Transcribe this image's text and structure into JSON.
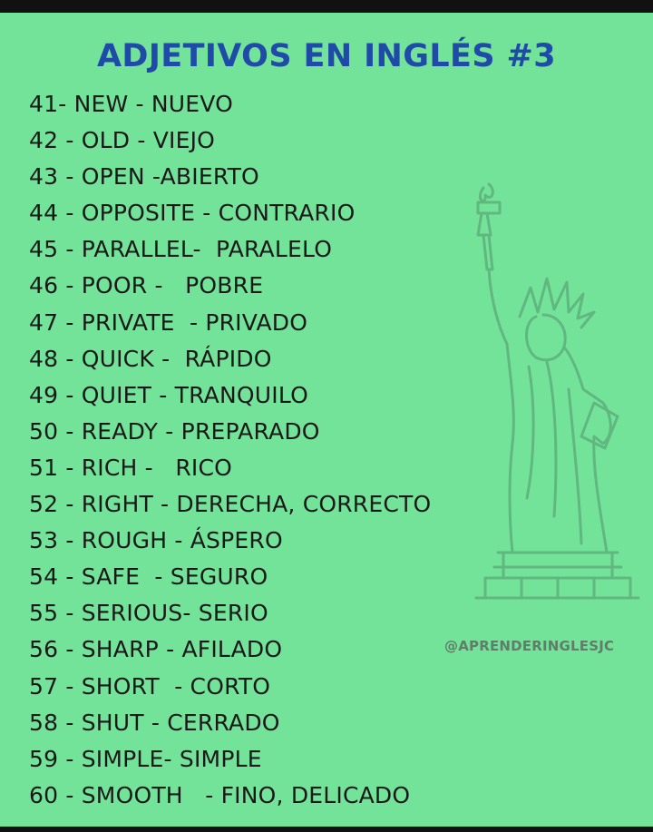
{
  "title": "ADJETIVOS EN INGLÉS #3",
  "items": [
    "41- NEW - NUEVO",
    "42 - OLD - VIEJO",
    "43 - OPEN -ABIERTO",
    "44 - OPPOSITE - CONTRARIO",
    "45 - PARALLEL-  PARALELO",
    "46 - POOR -   POBRE",
    "47 - PRIVATE  - PRIVADO",
    "48 - QUICK -  RÁPIDO",
    "49 - QUIET - TRANQUILO",
    "50 - READY - PREPARADO",
    "51 - RICH -   RICO",
    "52 - RIGHT - DERECHA, CORRECTO",
    "53 - ROUGH - ÁSPERO",
    "54 - SAFE  - SEGURO",
    "55 - SERIOUS- SERIO",
    "56 - SHARP - AFILADO",
    "57 - SHORT  - CORTO",
    "58 - SHUT - CERRADO",
    "59 - SIMPLE- SIMPLE",
    "60 - SMOOTH   - FINO, DELICADO"
  ],
  "watermark": "@APRENDERINGLESJC",
  "decoration": "statue-of-liberty-icon",
  "colors": {
    "background": "#73e39a",
    "title": "#1f4aa8",
    "text": "#191919",
    "outer_frame": "#111111"
  }
}
